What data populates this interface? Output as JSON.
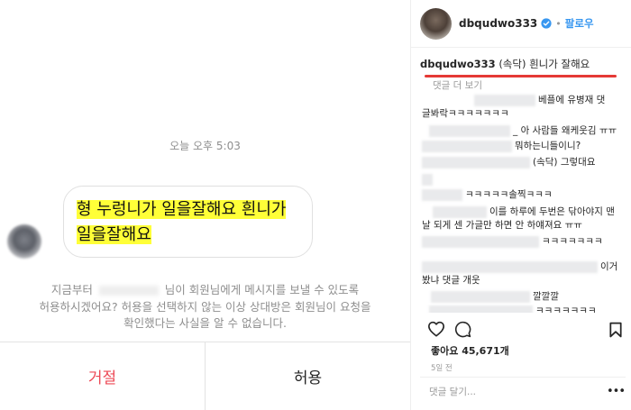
{
  "dm": {
    "timestamp": "오늘 오후 5:03",
    "message": "형 누렁니가 일을잘해요 흰니가 일을잘해요",
    "notice_line1_a": "지금부터",
    "notice_line1_b": "님이 회원님에게 메시지를 보낼 수 있도록",
    "notice_line2": "허용하시겠어요? 허용을 선택하지 않는 이상 상대방은 회원님이 요청을",
    "notice_line3": "확인했다는 사실을 알 수 없습니다.",
    "decline_label": "거절",
    "allow_label": "허용"
  },
  "post": {
    "username": "dbqudwo333",
    "follow_label": "팔로우",
    "separator": "•",
    "caption_user": "dbqudwo333",
    "caption_text": "(속닥) 흰니가 잘해요",
    "more_comments": "댓글 더 보기",
    "comments": [
      {
        "text": "베플에 유병재 댓"
      },
      {
        "text": "글봐락ㅋㅋㅋㅋㅋㅋㅋ"
      },
      {
        "text": "_ 아 사람들 왜케웃김 ㅠㅠ"
      },
      {
        "text": "뭐하는니들이니?"
      },
      {
        "text": "(속닥) 그렇대요"
      },
      {
        "text": "ㅋㅋㅋㅋㅋ솔찍ㅋㅋㅋ"
      },
      {
        "text": "이를 하루에 두번은 닦아야지 맨"
      },
      {
        "text": "날 되게 센 가글만 하면 안 하얘져요 ㅠㅠ"
      },
      {
        "text": "ㅋㅋㅋㅋㅋㅋㅋ"
      },
      {
        "text": "이거"
      },
      {
        "text": "봤냐 댓글 개웃"
      },
      {
        "text": "깔깔깔"
      },
      {
        "text": "ㅋㅋㅋㅋㅋㅋㅋ"
      }
    ],
    "likes": "좋아요 45,671개",
    "time": "5일 전",
    "comment_placeholder": "댓글 달기...",
    "more_dots": "•••"
  },
  "icons": {
    "like": "heart-icon",
    "comment": "comment-bubble-icon",
    "save": "bookmark-icon",
    "verified": "verified-badge-icon"
  },
  "colors": {
    "highlight": "#ffff38",
    "decline": "#ed4956",
    "follow": "#3897f0",
    "verified": "#3897f0",
    "underline": "#e53935"
  }
}
